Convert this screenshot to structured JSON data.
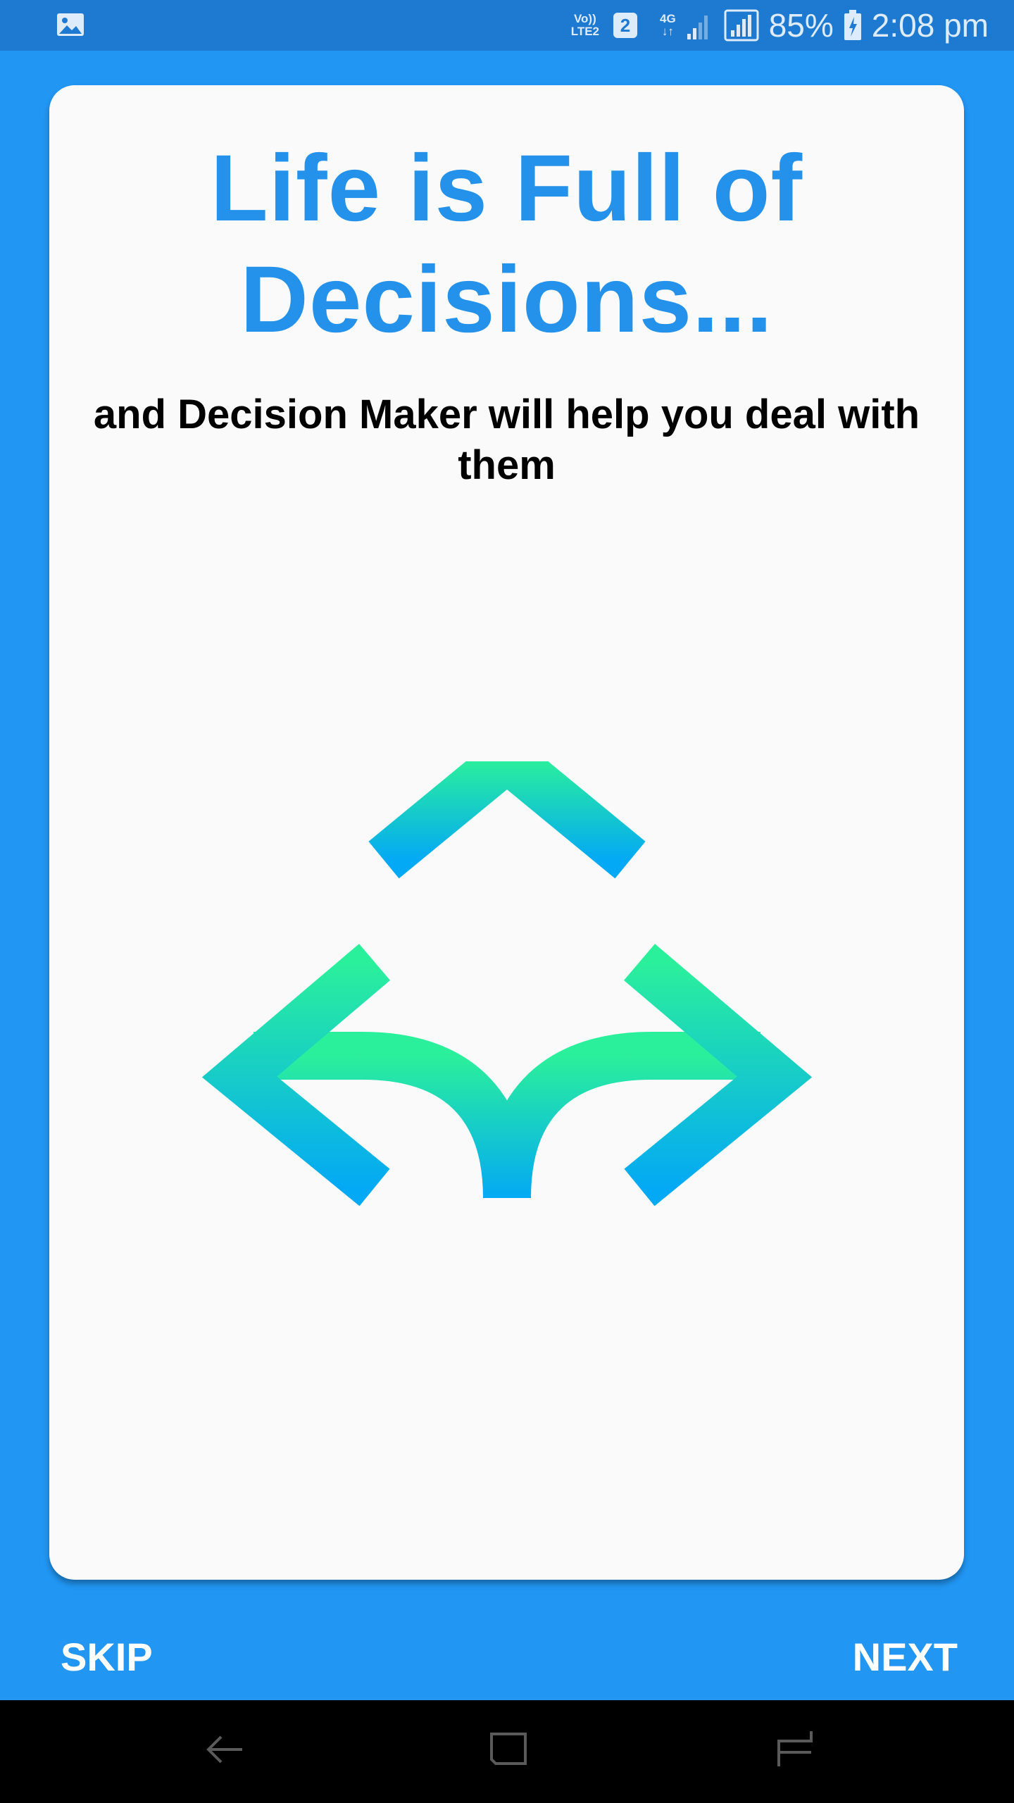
{
  "status_bar": {
    "left_icon": "gallery-icon",
    "volte_line1": "Vo))",
    "volte_line2": "LTE2",
    "sim_number": "2",
    "network_line1": "4G",
    "network_line2": "↓↑",
    "battery": "85%",
    "time": "2:08 pm",
    "colors": {
      "background": "#1E7AD0",
      "foreground": "#DDEBFA"
    }
  },
  "card": {
    "title": "Life is Full of Decisions...",
    "subtitle": "and Decision Maker will help you deal with them",
    "illustration": "three-way-arrows-icon",
    "gradient_top": "#2BF09B",
    "gradient_bottom": "#03A9F4"
  },
  "footer": {
    "skip_label": "SKIP",
    "next_label": "NEXT"
  },
  "nav_bar": {
    "icons": [
      "back-icon",
      "home-icon",
      "recent-apps-icon"
    ]
  },
  "colors": {
    "background": "#2196F3",
    "title": "#2492EA",
    "card": "#FAFAFA"
  }
}
